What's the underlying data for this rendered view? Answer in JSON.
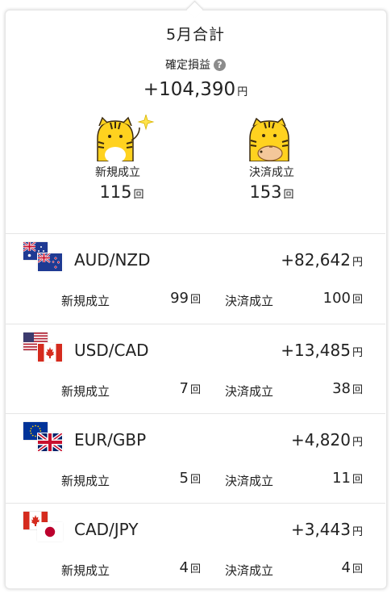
{
  "summary": {
    "month_title": "5月合計",
    "pl_label": "確定損益",
    "help_icon": "?",
    "pl_value": "+104,390",
    "yen": "円",
    "times": "回",
    "new_label": "新規成立",
    "new_count": "115",
    "settle_label": "決済成立",
    "settle_count": "153"
  },
  "pairs": [
    {
      "name": "AUD/NZD",
      "pl": "+82,642",
      "new_label": "新規成立",
      "new_count": "99",
      "settle_label": "決済成立",
      "settle_count": "100",
      "flags": [
        "australia-flag",
        "new-zealand-flag"
      ]
    },
    {
      "name": "USD/CAD",
      "pl": "+13,485",
      "new_label": "新規成立",
      "new_count": "7",
      "settle_label": "決済成立",
      "settle_count": "38",
      "flags": [
        "usa-flag",
        "canada-flag"
      ]
    },
    {
      "name": "EUR/GBP",
      "pl": "+4,820",
      "new_label": "新規成立",
      "new_count": "5",
      "settle_label": "決済成立",
      "settle_count": "11",
      "flags": [
        "eu-flag",
        "uk-flag"
      ]
    },
    {
      "name": "CAD/JPY",
      "pl": "+3,443",
      "new_label": "新規成立",
      "new_count": "4",
      "settle_label": "決済成立",
      "settle_count": "4",
      "flags": [
        "canada-flag",
        "japan-flag"
      ]
    }
  ],
  "colors": {
    "mascot_yellow": "#ffd21f",
    "text": "#222222",
    "divider": "#e5e5e5"
  }
}
